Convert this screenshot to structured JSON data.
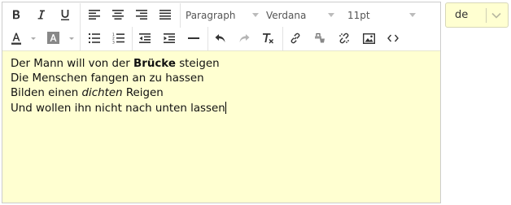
{
  "toolbar": {
    "format_block": "Paragraph",
    "font_family": "Verdana",
    "font_size": "11pt"
  },
  "content": {
    "lines": [
      {
        "before": "Der Mann will von der ",
        "emphasis": "Brücke",
        "after": " steigen"
      },
      {
        "text": "Die Menschen fangen an zu hassen"
      },
      {
        "before": "Bilden einen ",
        "emphasis": "dichten",
        "after": " Reigen"
      },
      {
        "text": "Und wollen ihn nicht nach unten lassen"
      }
    ]
  },
  "language_select": {
    "value": "de"
  },
  "colors": {
    "editor_background": "#ffffd1",
    "border": "#cccccc",
    "icon": "#333333",
    "disabled_icon": "#b5b5b5"
  }
}
